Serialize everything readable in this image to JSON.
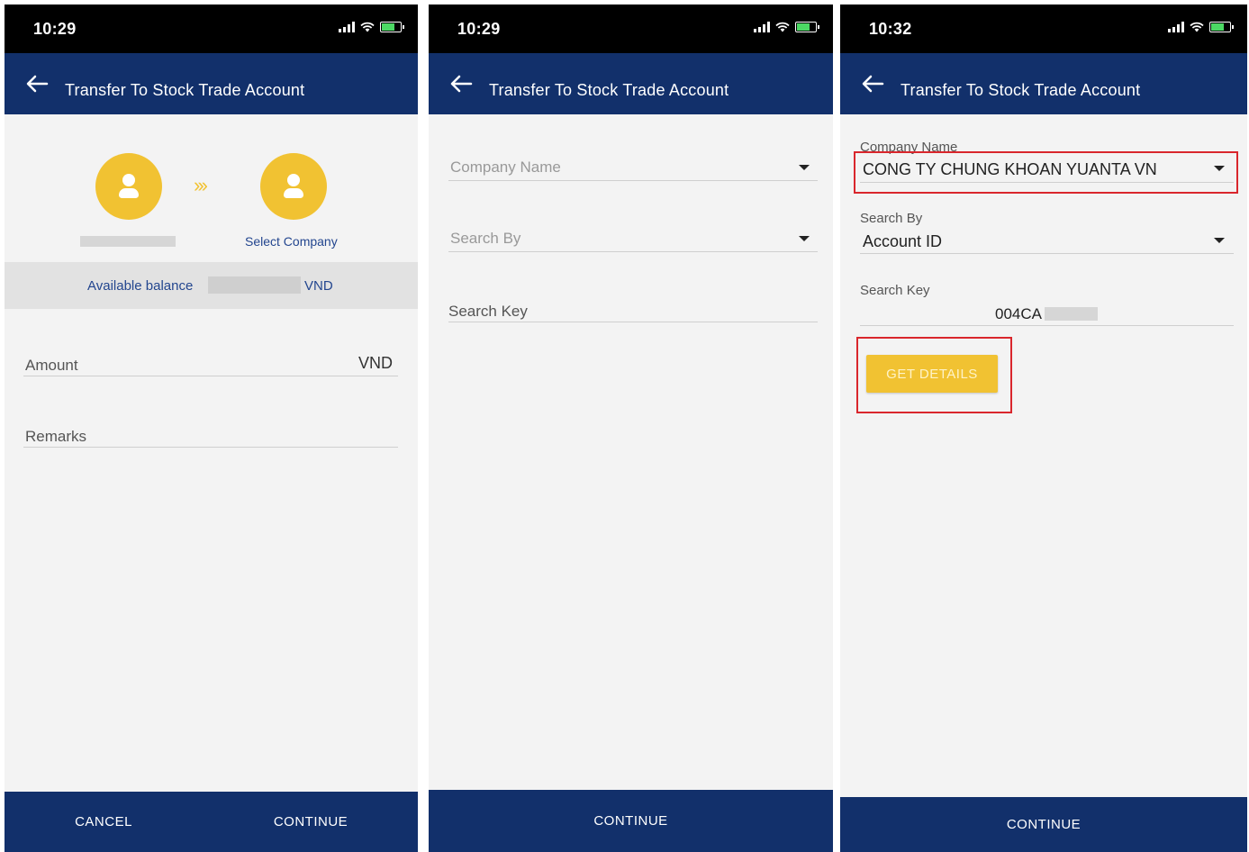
{
  "screens": [
    {
      "status": {
        "time": "10:29"
      },
      "header": {
        "title": "Transfer To Stock Trade Account"
      },
      "transfer": {
        "select_company": "Select Company"
      },
      "balance": {
        "label": "Available balance",
        "unit": "VND"
      },
      "form": {
        "amount_label": "Amount",
        "amount_unit": "VND",
        "remarks_label": "Remarks"
      },
      "footer": {
        "cancel": "CANCEL",
        "continue": "CONTINUE"
      }
    },
    {
      "status": {
        "time": "10:29"
      },
      "header": {
        "title": "Transfer To Stock Trade Account"
      },
      "form": {
        "company_placeholder": "Company Name",
        "search_by_placeholder": "Search By",
        "search_key_label": "Search Key"
      },
      "footer": {
        "continue": "CONTINUE"
      }
    },
    {
      "status": {
        "time": "10:32"
      },
      "header": {
        "title": "Transfer To Stock Trade Account"
      },
      "form": {
        "company_label": "Company Name",
        "company_value": "CONG TY CHUNG KHOAN YUANTA VN",
        "search_by_label": "Search By",
        "search_by_value": "Account ID",
        "search_key_label": "Search Key",
        "search_key_value": "004CA"
      },
      "get_details": "GET DETAILS",
      "footer": {
        "continue": "CONTINUE"
      }
    }
  ],
  "colors": {
    "primary": "#12306b",
    "accent": "#f1c232",
    "link": "#23468f",
    "highlight": "#d9262c"
  },
  "icons": [
    "back-arrow-icon",
    "signal-icon",
    "wifi-icon",
    "battery-icon",
    "user-icon",
    "chevron-right-icon",
    "dropdown-caret-icon"
  ]
}
